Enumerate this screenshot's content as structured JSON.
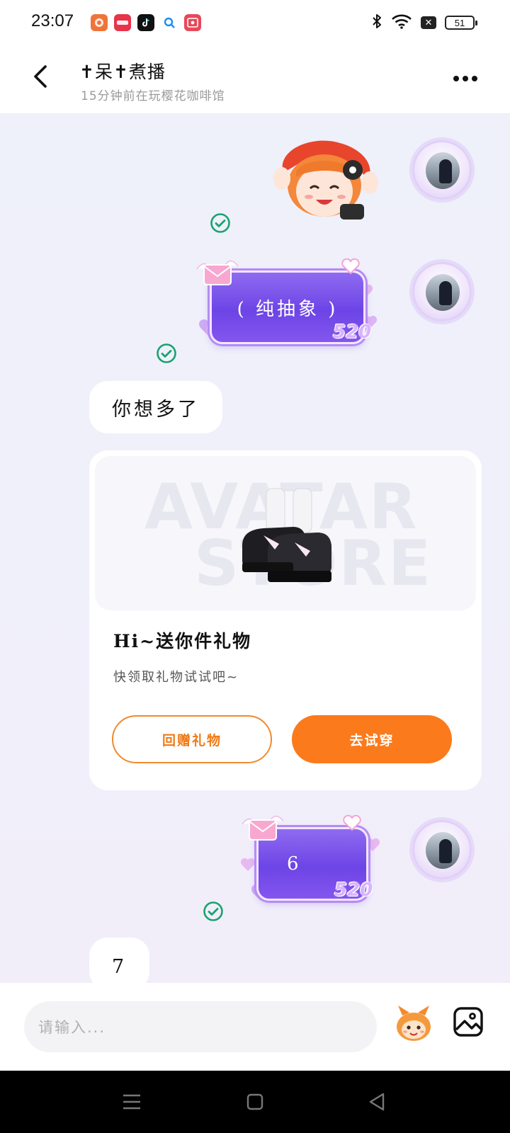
{
  "status_bar": {
    "time": "23:07",
    "battery": "51",
    "notifications": [
      {
        "icon": "app-orange-icon",
        "color": "#f0743a"
      },
      {
        "icon": "app-red-icon",
        "color": "#e8334a"
      },
      {
        "icon": "tiktok-icon",
        "color": "#111111"
      },
      {
        "icon": "search-app-icon",
        "color": "#ffffff"
      },
      {
        "icon": "record-icon",
        "color": "#e8485a"
      }
    ],
    "system_icons": [
      "bluetooth-icon",
      "wifi-icon",
      "close-box-icon",
      "battery-icon"
    ]
  },
  "header": {
    "name": "✝呆✝煮播",
    "status": "15分钟前在玩樱花咖啡馆"
  },
  "messages": {
    "gift1_text": "( 纯抽象 )",
    "gift1_badge": "520",
    "reply1": "你想多了",
    "gift2_text": "6",
    "gift2_badge": "520",
    "reply2": "7"
  },
  "gift_card": {
    "watermark_line1": "AVATAR",
    "watermark_line2": "STORE",
    "title": "Hi~送你件礼物",
    "subtitle": "快领取礼物试试吧~",
    "return_label": "回赠礼物",
    "try_label": "去试穿"
  },
  "input": {
    "placeholder": "请输入..."
  },
  "colors": {
    "accent_orange": "#fb7a1b",
    "check_green": "#1aa36f",
    "bubble_purple": "#7450e8"
  }
}
